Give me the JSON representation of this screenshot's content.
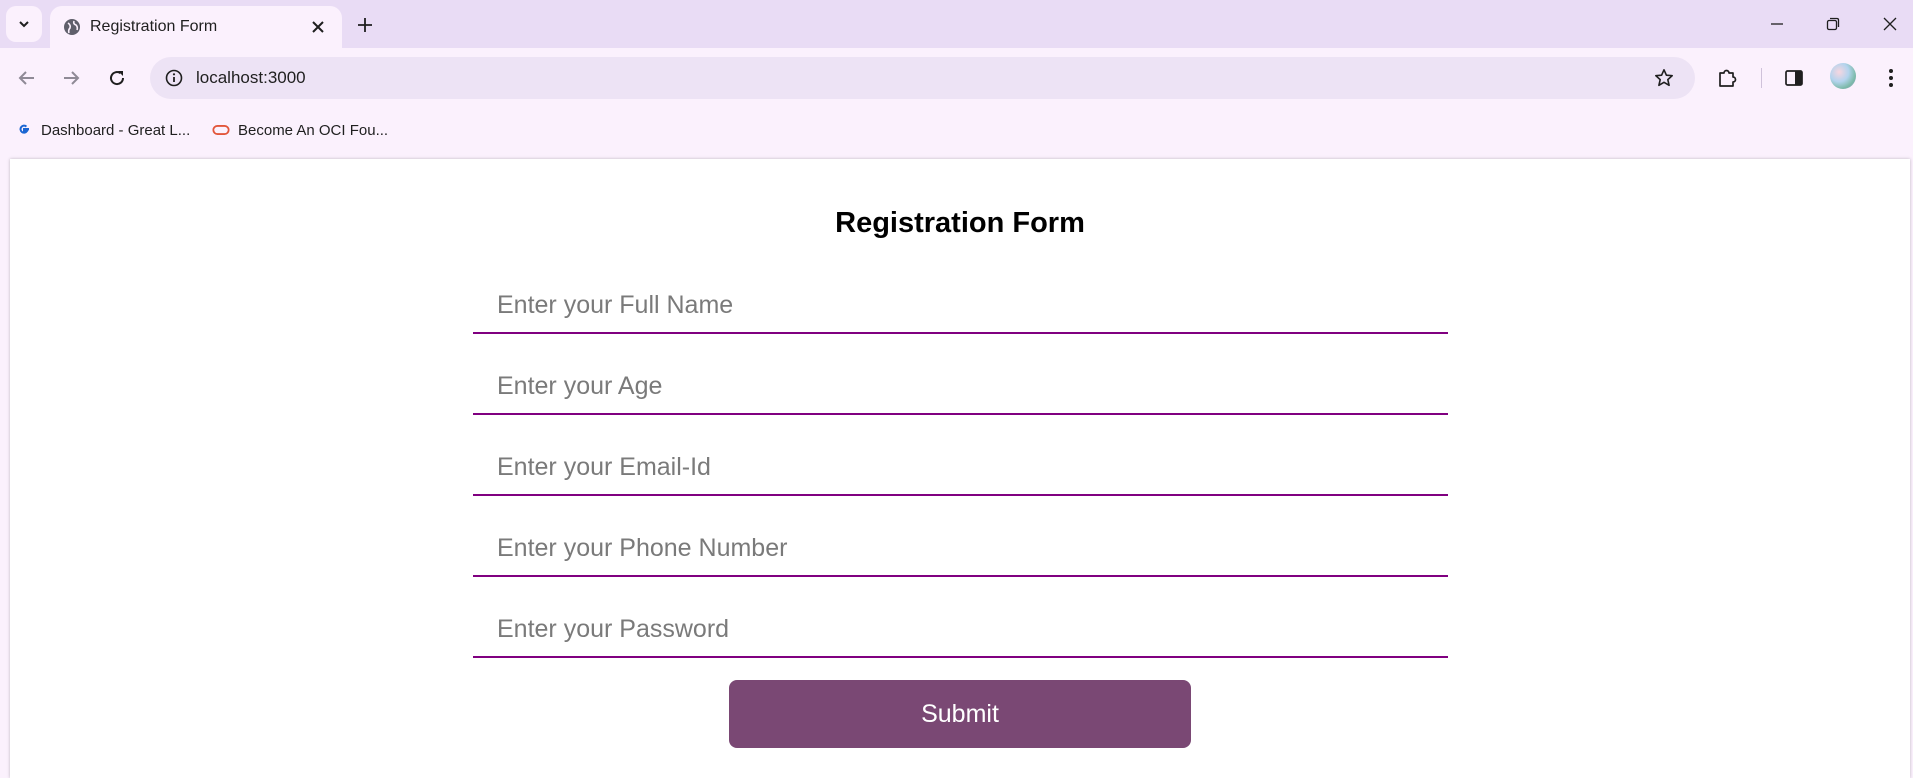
{
  "browser": {
    "tab": {
      "title": "Registration Form"
    },
    "address_bar": {
      "url": "localhost:3000"
    },
    "bookmarks": [
      {
        "label": "Dashboard - Great L...",
        "icon": "google-g-icon"
      },
      {
        "label": "Become An OCI Fou...",
        "icon": "oracle-icon"
      }
    ],
    "colors": {
      "tabstrip": "#e9dcf5",
      "toolbar": "#fbf1fd",
      "omnibox": "#ede3f5"
    }
  },
  "form": {
    "title": "Registration Form",
    "fields": [
      {
        "name": "full-name",
        "placeholder": "Enter your Full Name",
        "value": ""
      },
      {
        "name": "age",
        "placeholder": "Enter your Age",
        "value": ""
      },
      {
        "name": "email",
        "placeholder": "Enter your Email-Id",
        "value": ""
      },
      {
        "name": "phone",
        "placeholder": "Enter your Phone Number",
        "value": ""
      },
      {
        "name": "password",
        "placeholder": "Enter your Password",
        "value": ""
      }
    ],
    "submit_label": "Submit",
    "colors": {
      "field_underline": "#800080",
      "submit_bg": "#7a4874",
      "submit_text": "#ffffff"
    }
  }
}
